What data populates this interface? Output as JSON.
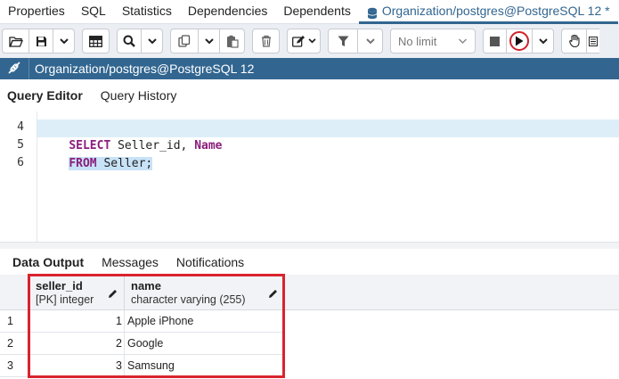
{
  "tabs": [
    {
      "label": "Properties"
    },
    {
      "label": "SQL"
    },
    {
      "label": "Statistics"
    },
    {
      "label": "Dependencies"
    },
    {
      "label": "Dependents"
    },
    {
      "label": "Organization/postgres@PostgreSQL 12 *",
      "active": true,
      "icon": "database-icon"
    }
  ],
  "toolbar": {
    "limit_label": "No limit",
    "icons": [
      "folder-open-icon",
      "save-icon",
      "chevron-down-icon",
      "grid-icon",
      "search-icon",
      "copy-icon",
      "paste-icon",
      "trash-icon",
      "edit-icon",
      "filter-icon",
      "stop-icon",
      "execute-icon",
      "hand-icon"
    ]
  },
  "connection": {
    "title": "Organization/postgres@PostgreSQL 12",
    "icon": "connection-icon"
  },
  "editor_tabs": [
    {
      "label": "Query Editor",
      "active": true
    },
    {
      "label": "Query History"
    }
  ],
  "editor": {
    "lines": [
      {
        "number": "4",
        "keyword1": "SELECT",
        "text1": " Seller_id, ",
        "keyword2": "Name",
        "text2": ""
      },
      {
        "number": "5",
        "keyword1": "FROM",
        "text1": " Seller;",
        "keyword2": "",
        "text2": ""
      },
      {
        "number": "6",
        "keyword1": "",
        "text1": "",
        "keyword2": "",
        "text2": ""
      }
    ]
  },
  "result_tabs": [
    {
      "label": "Data Output",
      "active": true
    },
    {
      "label": "Messages"
    },
    {
      "label": "Notifications"
    }
  ],
  "grid": {
    "columns": [
      {
        "name": "seller_id",
        "type": "[PK] integer"
      },
      {
        "name": "name",
        "type": "character varying (255)"
      }
    ],
    "rows": [
      {
        "num": "1",
        "seller_id": "1",
        "name": "Apple iPhone"
      },
      {
        "num": "2",
        "seller_id": "2",
        "name": "Google"
      },
      {
        "num": "3",
        "seller_id": "3",
        "name": "Samsung"
      }
    ]
  },
  "colors": {
    "brand": "#326690",
    "highlight_box": "#d9232e",
    "keyword": "#8a1e7c"
  }
}
